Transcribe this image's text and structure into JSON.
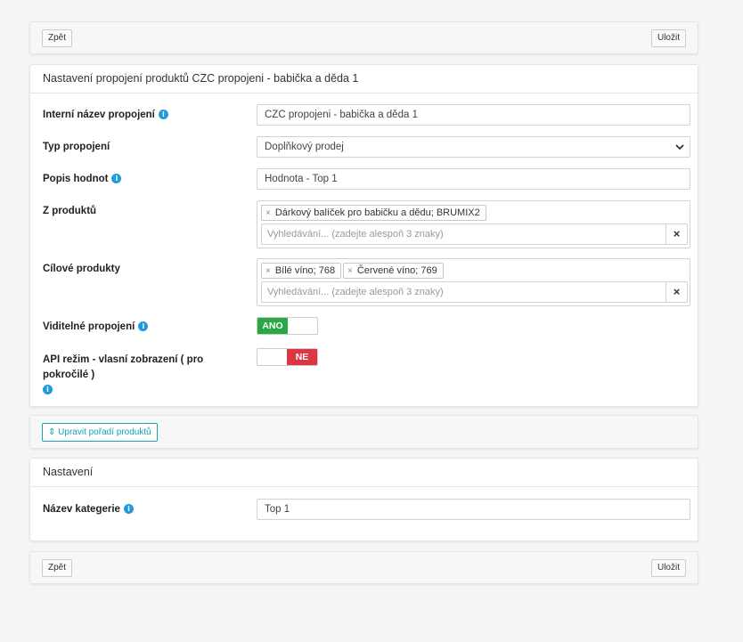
{
  "toolbar_top": {
    "back_label": "Zpět",
    "save_label": "Uložit"
  },
  "main_card": {
    "title": "Nastavení propojení produktů CZC propojeni - babička a děda 1",
    "fields": {
      "internal_name": {
        "label": "Interní název propojení",
        "value": "CZC propojeni - babička a děda 1"
      },
      "type": {
        "label": "Typ propojení",
        "value": "Doplňkový prodej"
      },
      "value_desc": {
        "label": "Popis hodnot",
        "value": "Hodnota - Top 1"
      },
      "from_products": {
        "label": "Z produktů",
        "tags": [
          "Dárkový balíček pro babičku a dědu; BRUMIX2"
        ],
        "search_placeholder": "Vyhledávání... (zadejte alespoň 3 znaky)"
      },
      "target_products": {
        "label": "Cílové produkty",
        "tags": [
          "Bílé víno; 768",
          "Červené víno; 769"
        ],
        "search_placeholder": "Vyhledávání... (zadejte alespoň 3 znaky)"
      },
      "visible": {
        "label": "Viditelné propojení",
        "value": "ANO"
      },
      "api_mode": {
        "label": "API režim - vlasní zobrazení ( pro pokročilé )",
        "value": "NE"
      }
    }
  },
  "order_bar": {
    "button_label": "Upravit pořadí produktů"
  },
  "settings_card": {
    "title": "Nastavení",
    "category_name": {
      "label": "Název kategerie",
      "value": "Top 1"
    }
  },
  "toolbar_bottom": {
    "back_label": "Zpět",
    "save_label": "Uložit"
  },
  "icons": {
    "info": "info-icon",
    "chevron": "chevron-down-icon",
    "tag_remove": "close-icon",
    "clear": "close-icon",
    "sort": "sort-icon"
  },
  "colors": {
    "info": "#1e9bd8",
    "toggle_on": "#28a745",
    "toggle_off": "#dc3545",
    "outline_button": "#17a2b8"
  }
}
